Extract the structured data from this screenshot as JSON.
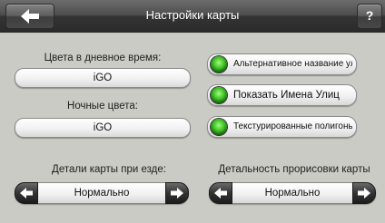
{
  "header": {
    "title": "Настройки карты",
    "back_icon": "arrow-left-icon",
    "help_label": "?"
  },
  "day_colors": {
    "label": "Цвета в дневное время:",
    "value": "iGO"
  },
  "night_colors": {
    "label": "Ночные цвета:",
    "value": "iGO"
  },
  "toggles": [
    {
      "label": "Альтернативное название улиц",
      "on": true
    },
    {
      "label": "Показать Имена Улиц",
      "on": true
    },
    {
      "label": "Текстурированные полигоны",
      "on": true
    }
  ],
  "driving_detail": {
    "label": "Детали карты при езде:",
    "value": "Нормально"
  },
  "render_detail": {
    "label": "Детальность прорисовки карты",
    "value": "Нормально"
  },
  "colors": {
    "accent_on": "#3ebc24",
    "titlebar": "#3a3a3a",
    "background": "#c9cbc4"
  }
}
